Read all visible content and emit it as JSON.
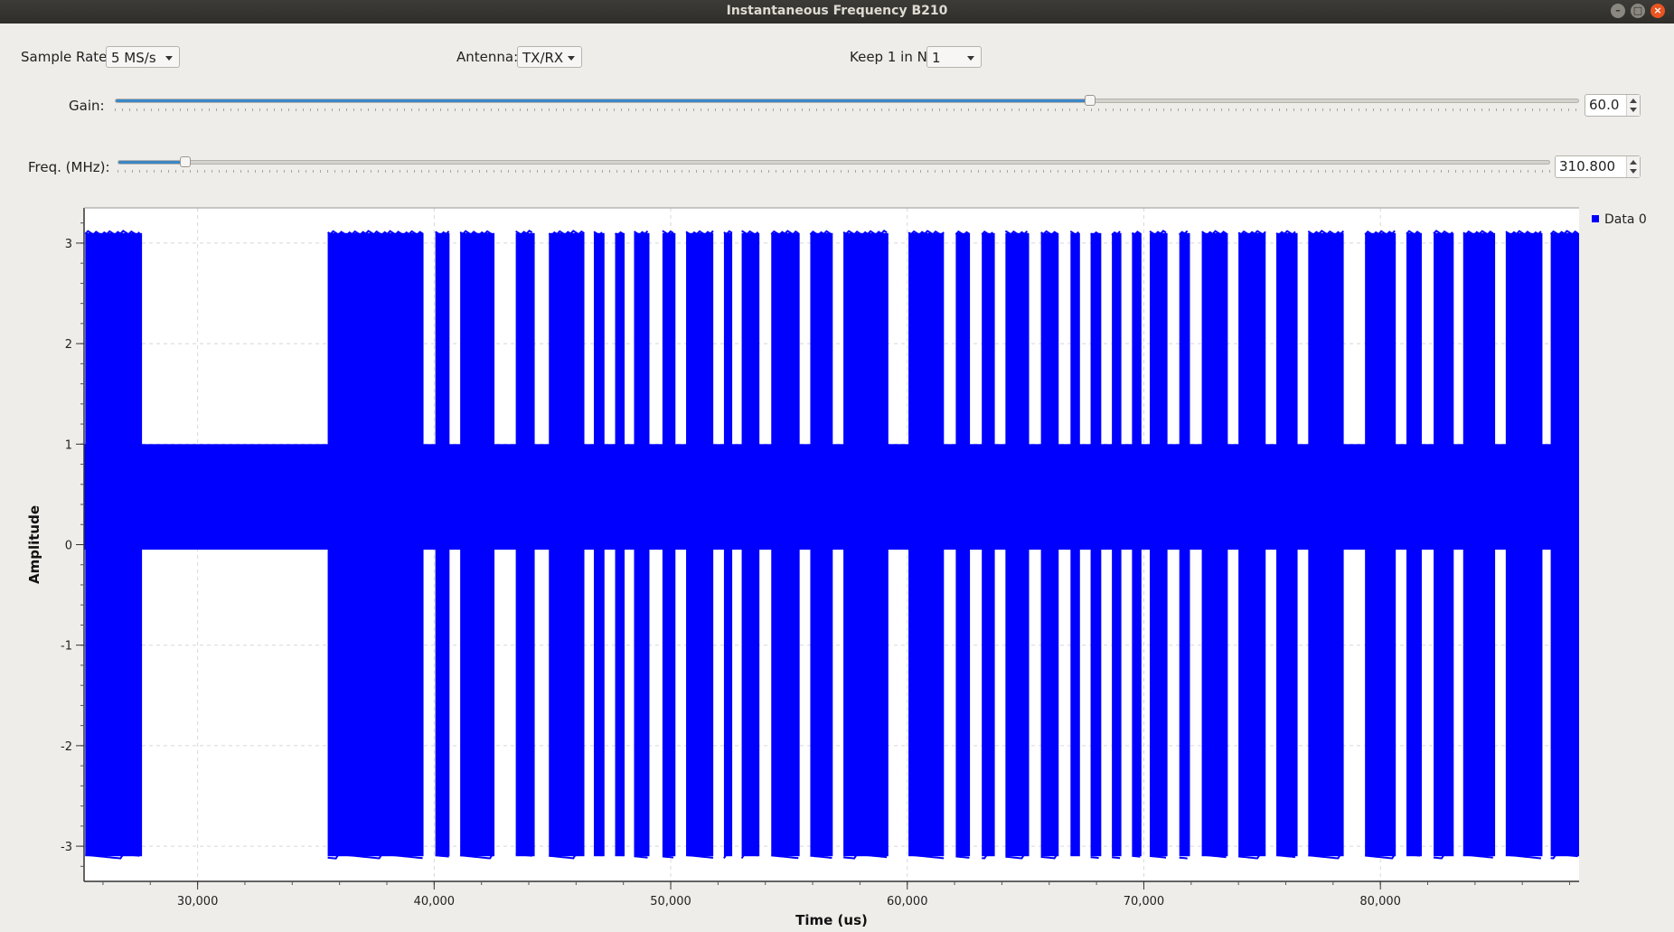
{
  "window": {
    "title": "Instantaneous Frequency B210"
  },
  "controls": {
    "sample_rate": {
      "label": "Sample Rate:",
      "value": "5 MS/s"
    },
    "antenna": {
      "label": "Antenna:",
      "value": "TX/RX"
    },
    "keep": {
      "label": "Keep 1 in N:",
      "value": "1"
    },
    "gain": {
      "label": "Gain:",
      "value": "60.0",
      "fraction": 0.666
    },
    "freq": {
      "label": "Freq. (MHz):",
      "value": "310.800",
      "fraction": 0.047
    }
  },
  "chart_data": {
    "type": "line",
    "xlabel": "Time (us)",
    "ylabel": "Amplitude",
    "x_ticks": [
      "30,000",
      "40,000",
      "50,000",
      "60,000",
      "70,000",
      "80,000"
    ],
    "y_ticks": [
      "3",
      "2",
      "1",
      "0",
      "-1",
      "-2",
      "-3"
    ],
    "xlim": [
      25200,
      88400
    ],
    "ylim": [
      -3.35,
      3.35
    ],
    "series": [
      {
        "name": "Data 0",
        "color": "#0000ff",
        "full_swing_segments_us": [
          [
            25250,
            27650
          ],
          [
            35500,
            39550
          ],
          [
            40050,
            40650
          ],
          [
            41100,
            42550
          ],
          [
            43450,
            44250
          ],
          [
            44850,
            46350
          ],
          [
            46750,
            47200
          ],
          [
            47650,
            48050
          ],
          [
            48450,
            49100
          ],
          [
            49650,
            50200
          ],
          [
            50650,
            51800
          ],
          [
            52250,
            52600
          ],
          [
            53000,
            53750
          ],
          [
            54250,
            55450
          ],
          [
            55900,
            56850
          ],
          [
            57300,
            59200
          ],
          [
            60050,
            61550
          ],
          [
            62050,
            62650
          ],
          [
            63150,
            63700
          ],
          [
            64150,
            65150
          ],
          [
            65650,
            66400
          ],
          [
            66900,
            67300
          ],
          [
            67750,
            68200
          ],
          [
            68650,
            69050
          ],
          [
            69500,
            69900
          ],
          [
            70250,
            71000
          ],
          [
            71500,
            71950
          ],
          [
            72450,
            73550
          ],
          [
            74000,
            75150
          ],
          [
            75600,
            76500
          ],
          [
            76950,
            78450
          ],
          [
            79350,
            80650
          ],
          [
            81100,
            81750
          ],
          [
            82250,
            83100
          ],
          [
            83500,
            84850
          ],
          [
            85300,
            86850
          ],
          [
            87200,
            88400
          ]
        ],
        "baseline_band": [
          -0.05,
          1.0
        ],
        "full_band": [
          -3.1,
          3.1
        ]
      }
    ]
  }
}
